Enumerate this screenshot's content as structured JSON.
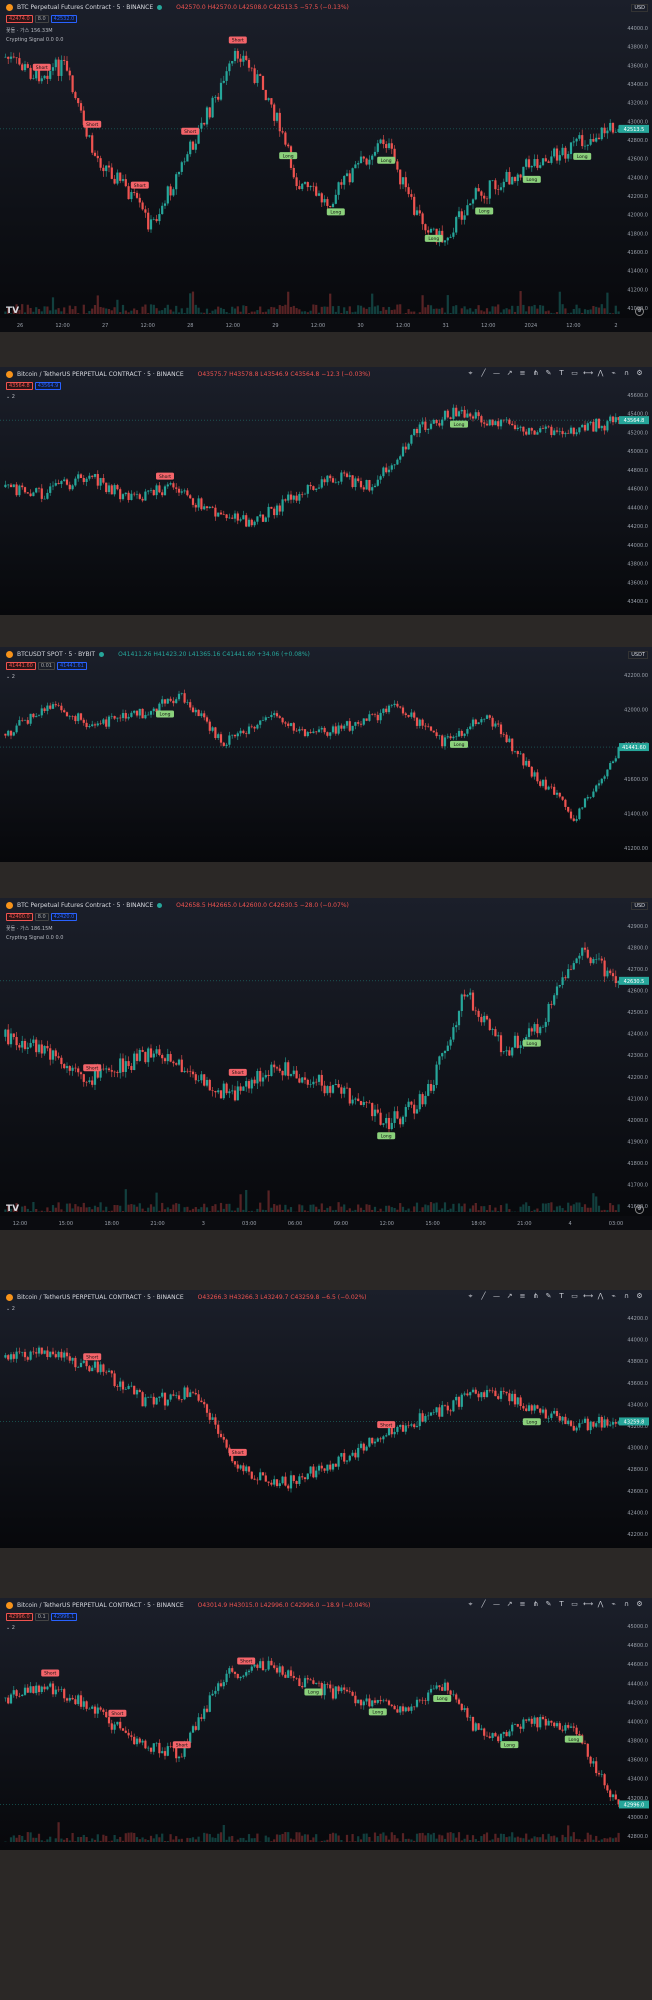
{
  "panels": [
    {
      "id": "p1",
      "header": {
        "symbol": "BTC Perpetual Futures Contract · 5 · BINANCE",
        "ohlc": "O42570.0  H42570.0  L42508.0  C42513.5  −57.5 (−0.13%)",
        "up": false
      },
      "prices": {
        "sell": "42474.0",
        "mid": "8.0",
        "buy": "42532.0"
      },
      "indicators": [
        "꽃돌 · 가스  156.33M",
        "Crypting Signal  0.0  0.0"
      ],
      "currency": "USD",
      "price_axis": [
        "44000.0",
        "43800.0",
        "43600.0",
        "43400.0",
        "43200.0",
        "43000.0",
        "42800.0",
        "42600.0",
        "42400.0",
        "42200.0",
        "42000.0",
        "41800.0",
        "41600.0",
        "41400.0",
        "41200.0",
        "41000.0"
      ],
      "last_price": "42513.5",
      "time_axis": [
        "26",
        "12:00",
        "27",
        "12:00",
        "28",
        "12:00",
        "29",
        "12:00",
        "30",
        "12:00",
        "31",
        "12:00",
        "2024",
        "12:00",
        "2"
      ],
      "signals": [
        {
          "label": "Short",
          "type": "short"
        },
        {
          "label": "Short",
          "type": "short"
        },
        {
          "label": "Short",
          "type": "short"
        },
        {
          "label": "Short",
          "type": "short"
        },
        {
          "label": "Short",
          "type": "short"
        },
        {
          "label": "Long",
          "type": "long"
        },
        {
          "label": "Long",
          "type": "long"
        },
        {
          "label": "Long",
          "type": "long"
        },
        {
          "label": "Long",
          "type": "long"
        },
        {
          "label": "Long",
          "type": "long"
        },
        {
          "label": "Long",
          "type": "long"
        },
        {
          "label": "Long",
          "type": "long"
        }
      ]
    },
    {
      "id": "p2",
      "header": {
        "symbol": "Bitcoin / TetherUS PERPETUAL CONTRACT · 5 · BINANCE",
        "ohlc": "O43575.7  H43578.8  L43546.9  C43564.8  −12.3 (−0.03%)",
        "up": false
      },
      "prices": {
        "sell": "43564.8",
        "mid": "",
        "buy": "43564.9"
      },
      "indicators": [
        "⌄ 2"
      ],
      "price_axis": [
        "45600.0",
        "45400.0",
        "45200.0",
        "45000.0",
        "44800.0",
        "44600.0",
        "44400.0",
        "44200.0",
        "44000.0",
        "43800.0",
        "43600.0",
        "43400.0"
      ],
      "last_price": "43564.8",
      "signals": [
        {
          "label": "Short",
          "type": "short"
        },
        {
          "label": "Long",
          "type": "long"
        }
      ]
    },
    {
      "id": "p3",
      "header": {
        "symbol": "BTCUSDT SPOT · 5 · BYBIT",
        "ohlc": "O41411.26  H41423.20  L41365.16  C41441.60  +34.06 (+0.08%)",
        "up": true
      },
      "prices": {
        "sell": "41441.60",
        "mid": "0.01",
        "buy": "41441.61"
      },
      "indicators": [
        "⌄ 2"
      ],
      "currency": "USDT",
      "price_axis": [
        "42200.00",
        "42000.00",
        "41800.00",
        "41600.00",
        "41400.00",
        "41200.00"
      ],
      "last_price": "41441.60",
      "signals": [
        {
          "label": "Long",
          "type": "long"
        },
        {
          "label": "Long",
          "type": "long"
        }
      ]
    },
    {
      "id": "p4",
      "header": {
        "symbol": "BTC Perpetual Futures Contract · 5 · BINANCE",
        "ohlc": "O42658.5  H42665.0  L42600.0  C42630.5  −28.0 (−0.07%)",
        "up": false
      },
      "prices": {
        "sell": "42400.0",
        "mid": "8.0",
        "buy": "42420.0"
      },
      "indicators": [
        "꽃돌 · 가스  186.15M",
        "Crypting Signal  0.0  0.0"
      ],
      "currency": "USD",
      "price_axis": [
        "42900.0",
        "42800.0",
        "42700.0",
        "42600.0",
        "42500.0",
        "42400.0",
        "42300.0",
        "42200.0",
        "42100.0",
        "42000.0",
        "41900.0",
        "41800.0",
        "41700.0",
        "41600.0"
      ],
      "last_price": "42630.5",
      "time_axis": [
        "12:00",
        "15:00",
        "18:00",
        "21:00",
        "3",
        "03:00",
        "06:00",
        "09:00",
        "12:00",
        "15:00",
        "18:00",
        "21:00",
        "4",
        "03:00"
      ],
      "signals": [
        {
          "label": "Short",
          "type": "short"
        },
        {
          "label": "Short",
          "type": "short"
        },
        {
          "label": "Long",
          "type": "long"
        },
        {
          "label": "Long",
          "type": "long"
        }
      ]
    },
    {
      "id": "p5",
      "header": {
        "symbol": "Bitcoin / TetherUS PERPETUAL CONTRACT · 5 · BINANCE",
        "ohlc": "O43266.3  H43266.3  L43249.7  C43259.8  −6.5 (−0.02%)",
        "up": false
      },
      "prices": {
        "sell": "",
        "mid": "",
        "buy": ""
      },
      "indicators": [
        "⌄ 2"
      ],
      "price_axis": [
        "44200.0",
        "44000.0",
        "43800.0",
        "43600.0",
        "43400.0",
        "43200.0",
        "43000.0",
        "42800.0",
        "42600.0",
        "42400.0",
        "42200.0"
      ],
      "last_price": "43259.8",
      "signals": [
        {
          "label": "Short",
          "type": "short"
        },
        {
          "label": "Short",
          "type": "short"
        },
        {
          "label": "Short",
          "type": "short"
        },
        {
          "label": "Long",
          "type": "long"
        }
      ]
    },
    {
      "id": "p6",
      "header": {
        "symbol": "Bitcoin / TetherUS PERPETUAL CONTRACT · 5 · BINANCE",
        "ohlc": "O43014.9  H43015.0  L42996.0  C42996.0  −18.9 (−0.04%)",
        "up": false
      },
      "prices": {
        "sell": "42996.0",
        "mid": "0.1",
        "buy": "42996.1"
      },
      "indicators": [
        "⌄ 2"
      ],
      "price_axis": [
        "45000.0",
        "44800.0",
        "44600.0",
        "44400.0",
        "44200.0",
        "44000.0",
        "43800.0",
        "43600.0",
        "43400.0",
        "43200.0",
        "43000.0",
        "42800.0"
      ],
      "last_price": "42996.0",
      "signals": [
        {
          "label": "Short",
          "type": "short"
        },
        {
          "label": "Short",
          "type": "short"
        },
        {
          "label": "Short",
          "type": "short"
        },
        {
          "label": "Short",
          "type": "short"
        },
        {
          "label": "Long",
          "type": "long"
        },
        {
          "label": "Long",
          "type": "long"
        },
        {
          "label": "Long",
          "type": "long"
        },
        {
          "label": "Long",
          "type": "long"
        },
        {
          "label": "Long",
          "type": "long"
        }
      ]
    }
  ],
  "toolbar_icons": [
    "cursor-icon",
    "trendline-icon",
    "horizontal-line-icon",
    "ray-icon",
    "fib-icon",
    "pitchfork-icon",
    "brush-icon",
    "text-icon",
    "rectangle-icon",
    "measure-icon",
    "pattern-icon",
    "forecast-icon",
    "magnet-icon",
    "gear-icon"
  ],
  "colors": {
    "up": "#26a69a",
    "down": "#ef5350",
    "bg": "#101217",
    "frame": "#2b2826"
  }
}
